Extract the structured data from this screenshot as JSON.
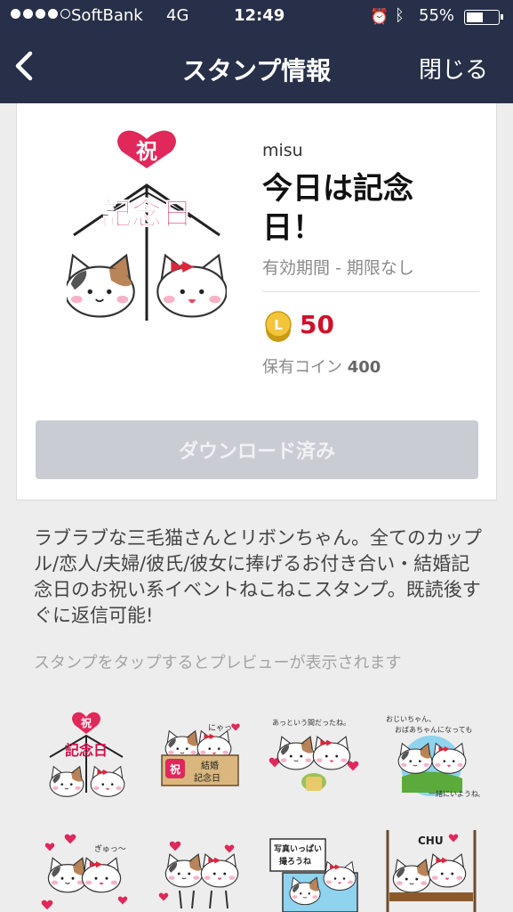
{
  "status_bar": {
    "carrier": "SoftBank",
    "network": "4G",
    "time": "12:49",
    "battery": "55%",
    "battery_level": 0.55
  },
  "nav": {
    "title": "スタンプ情報",
    "close_label": "閉じる"
  },
  "sticker": {
    "author": "misu",
    "name_line1": "今日は記念",
    "name_line2": "日！",
    "validity": "有効期間 - 期限なし",
    "price": "50",
    "owned_label": "保有コイン",
    "owned_amount": "400",
    "download_label": "ダウンロード済み",
    "main_image_text": "記念日",
    "main_image_badge": "祝"
  },
  "description": "ラブラブな三毛猫さんとリボンちゃん。全てのカップル/恋人/夫婦/彼氏/彼女に捧げるお付き合い・結婚記念日のお祝い系イベントねこねこスタンプ。既読後すぐに返信可能!",
  "preview_hint": "スタンプをタップするとプレビューが表示されます",
  "stickers_preview": [
    {
      "captions": [
        "祝",
        "記念日"
      ]
    },
    {
      "captions": [
        "にゃっ",
        "祝",
        "結婚",
        "記念日"
      ]
    },
    {
      "captions": [
        "あっという間だったね。"
      ]
    },
    {
      "captions": [
        "おじいちゃん、",
        "おばあちゃんになっても",
        "一緒にいようね。"
      ]
    },
    {
      "captions": [
        "ぎゅっ〜"
      ]
    },
    {
      "captions": []
    },
    {
      "captions": [
        "写真いっぱい",
        "撮ろうね"
      ]
    },
    {
      "captions": [
        "CHU"
      ]
    }
  ],
  "colors": {
    "header": "#273048",
    "price": "#d0102a",
    "heart": "#e0285a",
    "button_disabled": "#c9ccd3"
  },
  "icons": {
    "back": "chevron-left-icon",
    "alarm": "alarm-icon",
    "bluetooth": "bluetooth-icon",
    "coin": "coin-icon"
  }
}
